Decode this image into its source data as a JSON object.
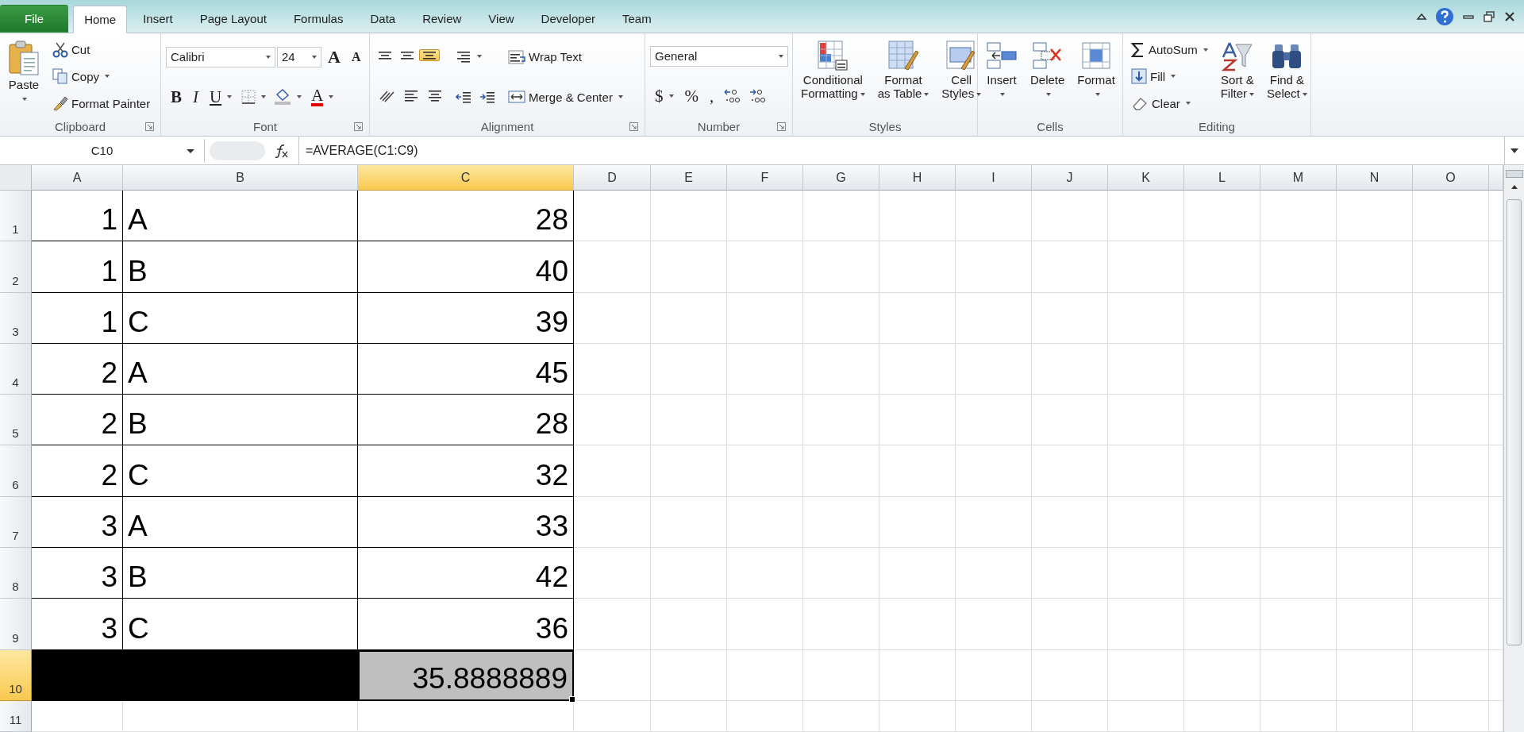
{
  "tabs": [
    {
      "label": "File",
      "kind": "file",
      "selected": false
    },
    {
      "label": "Home",
      "kind": "tab",
      "selected": true
    },
    {
      "label": "Insert",
      "kind": "tab",
      "selected": false
    },
    {
      "label": "Page Layout",
      "kind": "tab",
      "selected": false
    },
    {
      "label": "Formulas",
      "kind": "tab",
      "selected": false
    },
    {
      "label": "Data",
      "kind": "tab",
      "selected": false
    },
    {
      "label": "Review",
      "kind": "tab",
      "selected": false
    },
    {
      "label": "View",
      "kind": "tab",
      "selected": false
    },
    {
      "label": "Developer",
      "kind": "tab",
      "selected": false
    },
    {
      "label": "Team",
      "kind": "tab",
      "selected": false
    }
  ],
  "ribbon": {
    "groups": [
      {
        "label": "Clipboard",
        "launcher": true,
        "columns": [
          [
            [
              {
                "kind": "large",
                "lines": [
                  "Paste"
                ],
                "dropdown": true
              }
            ]
          ],
          [
            [
              {
                "kind": "small",
                "label": "Cut",
                "dropdown": false
              }
            ],
            [
              {
                "kind": "small",
                "label": "Copy",
                "dropdown": true
              }
            ],
            [
              {
                "kind": "small",
                "label": "Format Painter",
                "dropdown": false
              }
            ]
          ]
        ]
      },
      {
        "label": "Font",
        "launcher": true,
        "columns": [
          [
            [
              {
                "kind": "combo",
                "value": "Calibri"
              },
              {
                "kind": "combo",
                "value": "24"
              },
              {
                "kind": "grow",
                "label": "A",
                "dropdown": false
              },
              {
                "kind": "shrink",
                "label": "A",
                "dropdown": false
              }
            ],
            [
              {
                "kind": "bold",
                "label": "B",
                "dropdown": false
              },
              {
                "kind": "italic",
                "label": "I",
                "dropdown": false
              },
              {
                "kind": "underline",
                "label": "U",
                "dropdown": true
              },
              {
                "kind": "icon",
                "dropdown": true,
                "selected": false
              },
              {
                "kind": "icon",
                "dropdown": true,
                "selected": false
              },
              {
                "kind": "fontcolor",
                "label": "A",
                "dropdown": true
              }
            ]
          ]
        ]
      },
      {
        "label": "Alignment",
        "launcher": true,
        "columns": [
          [
            [
              {
                "kind": "icon",
                "dropdown": false,
                "selected": false
              },
              {
                "kind": "icon",
                "dropdown": false,
                "selected": false
              },
              {
                "kind": "icon",
                "dropdown": false,
                "selected": true
              }
            ],
            [
              {
                "kind": "icon",
                "dropdown": false,
                "selected": false
              },
              {
                "kind": "icon",
                "dropdown": false,
                "selected": false
              },
              {
                "kind": "icon",
                "dropdown": false,
                "selected": false
              }
            ]
          ],
          [
            [
              {
                "kind": "icon",
                "dropdown": true,
                "selected": false
              }
            ],
            [
              {
                "kind": "icon",
                "dropdown": false,
                "selected": false
              },
              {
                "kind": "icon",
                "dropdown": false,
                "selected": false
              }
            ]
          ],
          [
            [
              {
                "kind": "small",
                "label": "Wrap Text",
                "dropdown": false
              }
            ],
            [
              {
                "kind": "small",
                "label": "Merge & Center",
                "dropdown": true
              }
            ]
          ]
        ]
      },
      {
        "label": "Number",
        "launcher": true,
        "columns": [
          [
            [
              {
                "kind": "combo",
                "value": "General"
              }
            ],
            [
              {
                "kind": "symbol",
                "label": "$",
                "dropdown": true
              },
              {
                "kind": "symbol",
                "label": "%",
                "dropdown": false
              },
              {
                "kind": "symbol",
                "label": ",",
                "dropdown": false
              },
              {
                "kind": "icon",
                "dropdown": false,
                "selected": false
              },
              {
                "kind": "icon",
                "dropdown": false,
                "selected": false
              }
            ]
          ]
        ]
      },
      {
        "label": "Styles",
        "launcher": false,
        "columns": [
          [
            [
              {
                "kind": "large",
                "lines": [
                  "Conditional",
                  "Formatting"
                ],
                "dropdown": true
              }
            ]
          ],
          [
            [
              {
                "kind": "large",
                "lines": [
                  "Format",
                  "as Table"
                ],
                "dropdown": true
              }
            ]
          ],
          [
            [
              {
                "kind": "large",
                "lines": [
                  "Cell",
                  "Styles"
                ],
                "dropdown": true
              }
            ]
          ]
        ]
      },
      {
        "label": "Cells",
        "launcher": false,
        "columns": [
          [
            [
              {
                "kind": "large",
                "lines": [
                  "Insert"
                ],
                "dropdown": true
              }
            ]
          ],
          [
            [
              {
                "kind": "large",
                "lines": [
                  "Delete"
                ],
                "dropdown": true
              }
            ]
          ],
          [
            [
              {
                "kind": "large",
                "lines": [
                  "Format"
                ],
                "dropdown": true
              }
            ]
          ]
        ]
      },
      {
        "label": "Editing",
        "launcher": false,
        "columns": [
          [
            [
              {
                "kind": "small",
                "label": "AutoSum",
                "dropdown": true
              }
            ],
            [
              {
                "kind": "small",
                "label": "Fill",
                "dropdown": true
              }
            ],
            [
              {
                "kind": "small",
                "label": "Clear",
                "dropdown": true
              }
            ]
          ],
          [
            [
              {
                "kind": "large",
                "lines": [
                  "Sort &",
                  "Filter"
                ],
                "dropdown": true
              }
            ]
          ],
          [
            [
              {
                "kind": "large",
                "lines": [
                  "Find &",
                  "Select"
                ],
                "dropdown": true
              }
            ]
          ]
        ]
      }
    ]
  },
  "formula_bar": {
    "name_box": "C10",
    "formula": "=AVERAGE(C1:C9)"
  },
  "sheet": {
    "columns": [
      {
        "label": "A",
        "selected": false
      },
      {
        "label": "B",
        "selected": false
      },
      {
        "label": "C",
        "selected": true
      },
      {
        "label": "D",
        "selected": false
      },
      {
        "label": "E",
        "selected": false
      },
      {
        "label": "F",
        "selected": false
      },
      {
        "label": "G",
        "selected": false
      },
      {
        "label": "H",
        "selected": false
      },
      {
        "label": "I",
        "selected": false
      },
      {
        "label": "J",
        "selected": false
      },
      {
        "label": "K",
        "selected": false
      },
      {
        "label": "L",
        "selected": false
      },
      {
        "label": "M",
        "selected": false
      },
      {
        "label": "N",
        "selected": false
      },
      {
        "label": "O",
        "selected": false
      }
    ],
    "rows": [
      {
        "label": "1",
        "selected": false,
        "kind": "data",
        "a": "1",
        "b": "A",
        "c": "28"
      },
      {
        "label": "2",
        "selected": false,
        "kind": "data",
        "a": "1",
        "b": "B",
        "c": "40"
      },
      {
        "label": "3",
        "selected": false,
        "kind": "data",
        "a": "1",
        "b": "C",
        "c": "39"
      },
      {
        "label": "4",
        "selected": false,
        "kind": "data",
        "a": "2",
        "b": "A",
        "c": "45"
      },
      {
        "label": "5",
        "selected": false,
        "kind": "data",
        "a": "2",
        "b": "B",
        "c": "28"
      },
      {
        "label": "6",
        "selected": false,
        "kind": "data",
        "a": "2",
        "b": "C",
        "c": "32"
      },
      {
        "label": "7",
        "selected": false,
        "kind": "data",
        "a": "3",
        "b": "A",
        "c": "33"
      },
      {
        "label": "8",
        "selected": false,
        "kind": "data",
        "a": "3",
        "b": "B",
        "c": "42"
      },
      {
        "label": "9",
        "selected": false,
        "kind": "data",
        "a": "3",
        "b": "C",
        "c": "36"
      },
      {
        "label": "10",
        "selected": true,
        "kind": "result",
        "c": "35.8888889"
      },
      {
        "label": "11",
        "selected": false,
        "kind": "empty"
      }
    ]
  }
}
